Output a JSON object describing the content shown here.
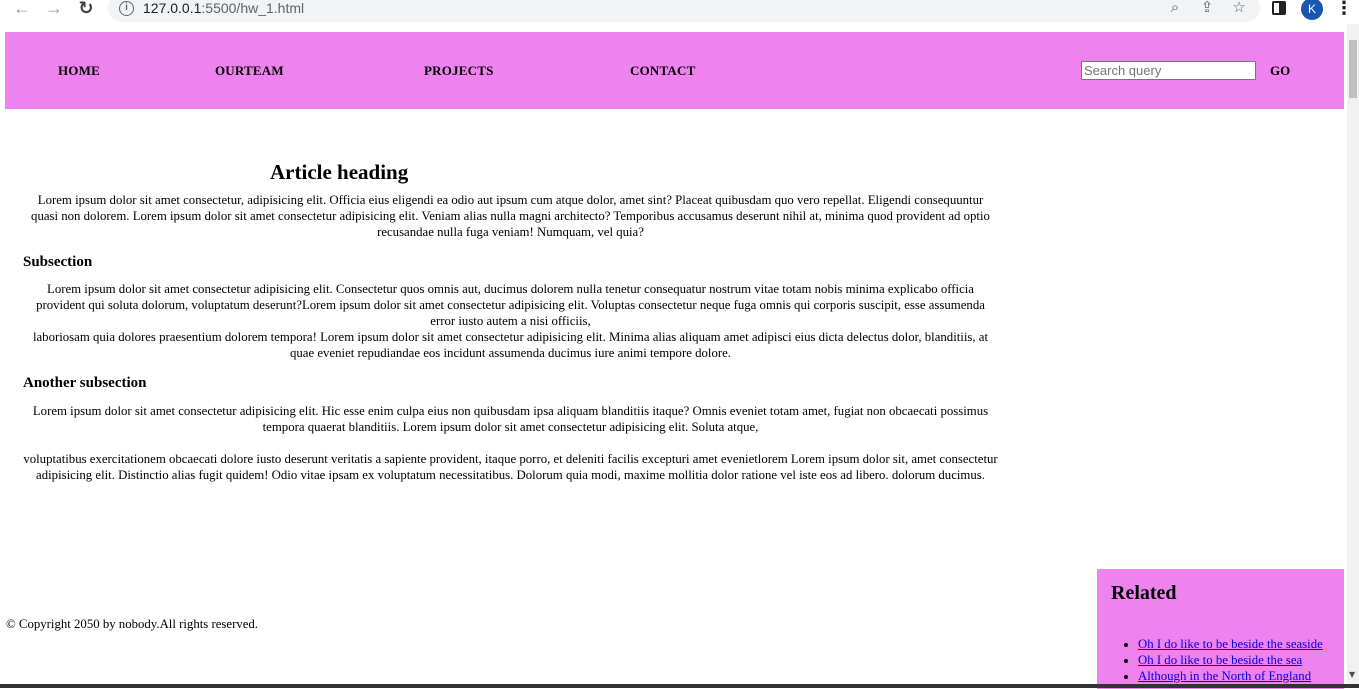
{
  "browser": {
    "back_icon": "←",
    "forward_icon": "→",
    "reload_icon": "↻",
    "info_icon": "i",
    "url_host": "127.0.0.1",
    "url_rest": ":5500/hw_1.html",
    "zoom_icon": "⌕",
    "share_icon": "⇪",
    "star_icon": "☆",
    "profile_initial": "K",
    "menu_icon": "⋮"
  },
  "header": {
    "nav": [
      "HOME",
      "OURTEAM",
      "PROJECTS",
      "CONTACT"
    ],
    "search_placeholder": "Search query",
    "go_label": "GO",
    "background": "#ee82ee"
  },
  "article": {
    "heading": "Article heading",
    "intro": "Lorem ipsum dolor sit amet consectetur, adipisicing elit. Officia eius eligendi ea odio aut ipsum cum atque dolor, amet sint? Placeat quibusdam quo vero repellat. Eligendi consequuntur quasi non dolorem. Lorem ipsum dolor sit amet consectetur adipisicing elit. Veniam alias nulla magni architecto? Temporibus accusamus deserunt nihil at, minima quod provident ad optio recusandae nulla fuga veniam! Numquam, vel quia?",
    "subsection1": {
      "title": "Subsection",
      "line1": "Lorem ipsum dolor sit amet consectetur adipisicing elit. Consectetur quos omnis aut, ducimus dolorem nulla tenetur consequatur nostrum vitae totam nobis minima explicabo officia provident qui soluta dolorum, voluptatum deserunt?Lorem ipsum dolor sit amet consectetur adipisicing elit. Voluptas consectetur neque fuga omnis qui corporis suscipit, esse assumenda error iusto autem a nisi officiis,",
      "line2": "laboriosam quia dolores praesentium dolorem tempora! Lorem ipsum dolor sit amet consectetur adipisicing elit. Minima alias aliquam amet adipisci eius dicta delectus dolor, blanditiis, at quae eveniet repudiandae eos incidunt assumenda ducimus iure animi tempore dolore."
    },
    "subsection2": {
      "title": "Another subsection",
      "para1": "Lorem ipsum dolor sit amet consectetur adipisicing elit. Hic esse enim culpa eius non quibusdam ipsa aliquam blanditiis itaque? Omnis eveniet totam amet, fugiat non obcaecati possimus tempora quaerat blanditiis. Lorem ipsum dolor sit amet consectetur adipisicing elit. Soluta atque,",
      "para2": "voluptatibus exercitationem obcaecati dolore iusto deserunt veritatis a sapiente provident, itaque porro, et deleniti facilis excepturi amet evenietlorem Lorem ipsum dolor sit, amet consectetur adipisicing elit. Distinctio alias fugit quidem! Odio vitae ipsam ex voluptatum necessitatibus. Dolorum quia modi, maxime mollitia dolor ratione vel iste eos ad libero. dolorum ducimus."
    }
  },
  "footer": {
    "copyright": "© Copyright 2050 by nobody.All rights reserved."
  },
  "related": {
    "title": "Related",
    "links": [
      "Oh I do like to be beside the seaside",
      "Oh I do like to be beside the sea",
      "Although in the North of England"
    ]
  }
}
